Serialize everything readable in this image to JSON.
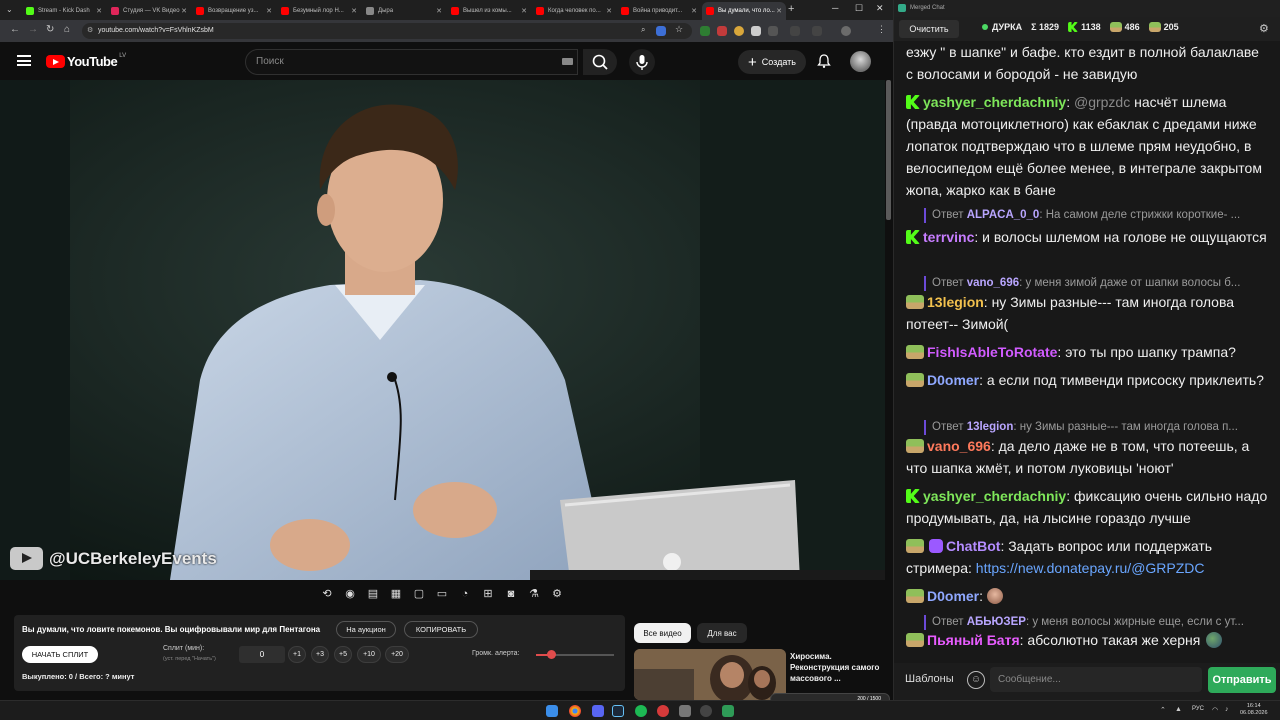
{
  "browser": {
    "tabs": [
      {
        "label": "Stream - Kick Dash",
        "color": "#53fc18"
      },
      {
        "label": "Студия — VK Видео",
        "color": "#e0265a"
      },
      {
        "label": "Возвращение уз...",
        "color": "#ff0000"
      },
      {
        "label": "Безумный лор Н...",
        "color": "#ff0000"
      },
      {
        "label": "Дыра",
        "color": "#888888"
      },
      {
        "label": "Вышел из комы...",
        "color": "#ff0000"
      },
      {
        "label": "Когда человек по...",
        "color": "#ff0000"
      },
      {
        "label": "Война приводит...",
        "color": "#ff0000"
      },
      {
        "label": "Вы думали, что ло...",
        "color": "#ff0000"
      }
    ],
    "new_tab": "+",
    "url": "youtube.com/watch?v=FsVhlnKZsbM"
  },
  "youtube": {
    "logo_text": "YouTube",
    "country_code": "LV",
    "search_placeholder": "Поиск",
    "create_label": "Создать",
    "watermark": "@UCBerkeleyEvents"
  },
  "panel": {
    "title": "Вы думали, что ловите покемонов. Вы оцифровывали мир для Пентагона",
    "auction_label": "На аукцион",
    "copy_label": "КОПИРОВАТЬ",
    "start_split_label": "НАЧАТЬ СПЛИТ",
    "split_label": "Сплит (мин):",
    "split_hint": "(уст. перед \"Начать\")",
    "split_value": "0",
    "steps": [
      "+1",
      "+3",
      "+5",
      "+10",
      "+20"
    ],
    "alert_volume_label": "Громк. алерта:",
    "alert_volume_level": 0.19,
    "bought_text": "Выкуплено: 0 / Всего: ? минут"
  },
  "recommendations": {
    "chips": [
      "Все видео",
      "Для вас"
    ],
    "title": "Хиросима. Реконструкция самого массового ...",
    "progress_text": "200 / 1500"
  },
  "chat": {
    "window_title": "Merged Chat",
    "clear_label": "Очистить",
    "stats": {
      "channel": "ДУРКА",
      "sum_label": "Σ 1829",
      "kick_count": "1138",
      "twitch_count": "486",
      "vk_count": "205"
    },
    "messages": [
      {
        "type": "cont",
        "text": "езжу \" в шапке\" и бафе. кто ездит в полной балаклаве с волосами и бородой - не завидую"
      },
      {
        "type": "msg",
        "badge": "kick",
        "user": "yashyer_cherdachniy",
        "color": "#7ee65a",
        "mention": "@grpzdc",
        "text": "насчёт шлема (правда мотоциклетного) как ебаклак с дредами ниже лопаток подтверждаю что в шлеме прям неудобно, в велосипедом ещё более менее, в интеграле закрытом жопа, жарко как в бане"
      },
      {
        "type": "reply",
        "prefix": "Ответ",
        "user": "ALPACA_0_0",
        "text": "На самом деле стрижки короткие- ..."
      },
      {
        "type": "msg",
        "badge": "kick",
        "user": "terrvinc",
        "color": "#c77dff",
        "text": "и волосы шлемом на голове не ощущаются"
      },
      {
        "type": "reply",
        "prefix": "Ответ",
        "user": "vano_696",
        "text": "у меня зимой даже от шапки волосы б..."
      },
      {
        "type": "msg",
        "badge": "pepe",
        "user": "13legion",
        "color": "#f2c14e",
        "text": "ну  Зимы разные--- там иногда голова потеет-- Зимой("
      },
      {
        "type": "msg",
        "badge": "pepe",
        "user": "FishIsAbleToRotate",
        "color": "#d15cff",
        "text": "это ты про шапку трампа?"
      },
      {
        "type": "msg",
        "badge": "pepe",
        "user": "D0omer",
        "color": "#8fa8ff",
        "text": "а если под тимвенди присоску приклеить?"
      },
      {
        "type": "reply",
        "prefix": "Ответ",
        "user": "13legion",
        "text": "ну Зимы разные--- там иногда голова п..."
      },
      {
        "type": "msg",
        "badge": "pepe",
        "user": "vano_696",
        "color": "#ff7a5c",
        "text": "да дело даже не в том, что потеешь, а что шапка жмёт, и потом луковицы 'ноют'"
      },
      {
        "type": "msg",
        "badge": "kick",
        "user": "yashyer_cherdachniy",
        "color": "#7ee65a",
        "text": "фиксацию очень сильно надо продумывать, да, на лысине гораздо лучше"
      },
      {
        "type": "msg",
        "badge": "pepe",
        "bot": true,
        "user": "ChatBot",
        "color": "#b48cff",
        "text": "Задать вопрос или поддержать стримера:",
        "link": "https://new.donatepay.ru/@GRPZDC"
      },
      {
        "type": "msg",
        "badge": "pepe",
        "user": "D0omer",
        "color": "#8fa8ff",
        "text": ""
      },
      {
        "type": "reply",
        "prefix": "Ответ",
        "user": "АБЬЮЗЕР",
        "text": "у меня волосы жирные еще, если с ут..."
      },
      {
        "type": "msg",
        "badge": "pepe",
        "user": "Пьяный Батя",
        "color": "#e85cff",
        "text": "абсолютно такая же херня"
      }
    ],
    "templates_label": "Шаблоны",
    "input_placeholder": "Сообщение...",
    "send_label": "Отправить"
  },
  "taskbar": {
    "lang": "РУС",
    "time": "16:14",
    "date": "06.08.2026"
  }
}
